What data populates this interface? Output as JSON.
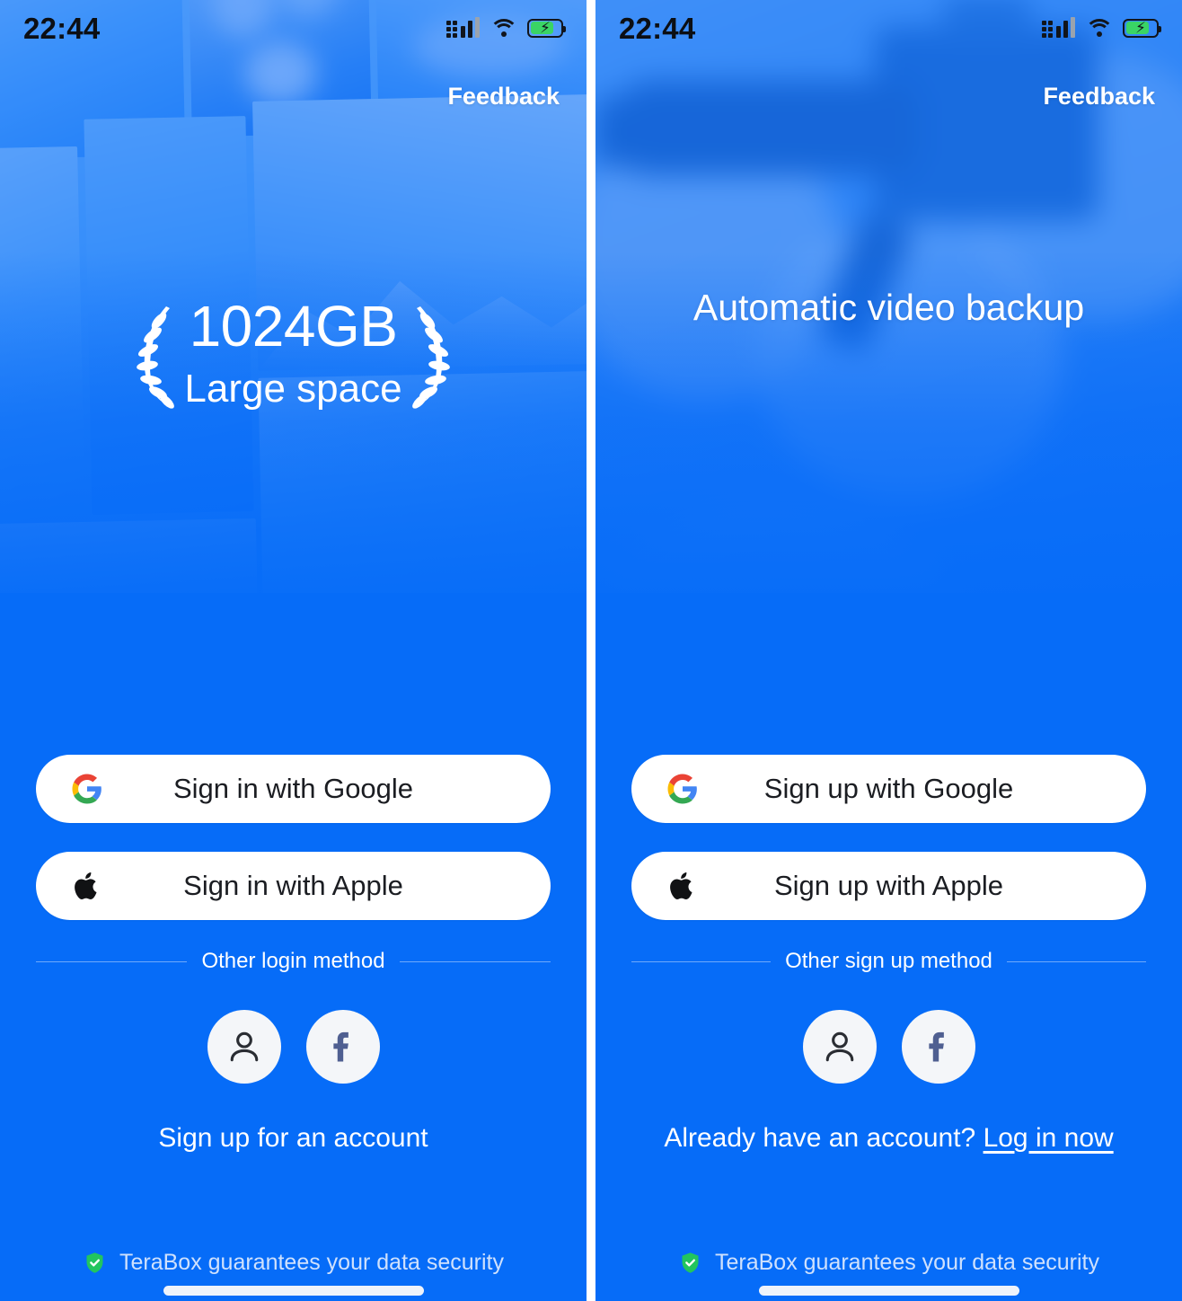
{
  "statusbar": {
    "time": "22:44",
    "signal_icon": "signal-bars-icon",
    "wifi_icon": "wifi-icon",
    "battery_icon": "battery-charging-icon",
    "battery_charging": true
  },
  "left": {
    "feedback_label": "Feedback",
    "hero": {
      "headline": "1024GB",
      "subhead": "Large space",
      "wreath_icon": "laurel-wreath-icon"
    },
    "buttons": [
      {
        "label": "Sign in with Google",
        "icon": "google-icon"
      },
      {
        "label": "Sign in with Apple",
        "icon": "apple-icon"
      }
    ],
    "divider_label": "Other login method",
    "socials": [
      {
        "icon": "person-icon",
        "name": "account-login"
      },
      {
        "icon": "facebook-icon",
        "name": "facebook-login"
      }
    ],
    "bottom_link": "Sign up for an account",
    "footer_text": "TeraBox guarantees your data security",
    "footer_icon": "shield-check-icon"
  },
  "right": {
    "feedback_label": "Feedback",
    "hero": {
      "headline": "Automatic video backup"
    },
    "buttons": [
      {
        "label": "Sign up with Google",
        "icon": "google-icon"
      },
      {
        "label": "Sign up with Apple",
        "icon": "apple-icon"
      }
    ],
    "divider_label": "Other sign up method",
    "socials": [
      {
        "icon": "person-icon",
        "name": "account-signup"
      },
      {
        "icon": "facebook-icon",
        "name": "facebook-signup"
      }
    ],
    "bottom_link_prefix": "Already have an account? ",
    "bottom_link_action": "Log in now",
    "footer_text": "TeraBox guarantees your data security",
    "footer_icon": "shield-check-icon"
  },
  "colors": {
    "brand_blue": "#066CF8",
    "button_white": "#FFFFFF",
    "shield_green": "#22C55E",
    "facebook_blue": "#4F5F91",
    "footer_text": "#CFE1FD",
    "battery_green": "#3AD465"
  }
}
